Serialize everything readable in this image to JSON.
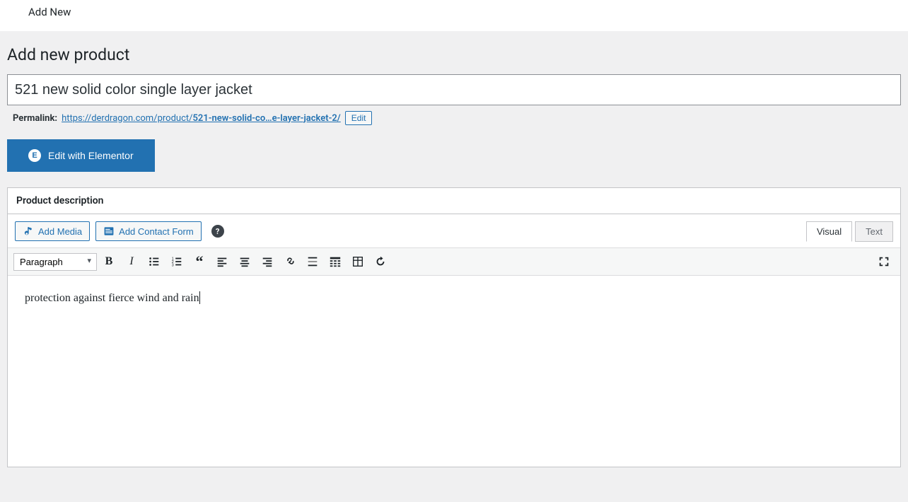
{
  "top_bar": {
    "add_new": "Add New"
  },
  "page": {
    "title": "Add new product"
  },
  "product": {
    "title": "521 new solid color single layer jacket"
  },
  "permalink": {
    "label": "Permalink:",
    "base": "https://derdragon.com/product/",
    "slug": "521-new-solid-co…e-layer-jacket-2/",
    "edit_label": "Edit"
  },
  "elementor": {
    "label": "Edit with Elementor"
  },
  "panel": {
    "title": "Product description"
  },
  "media": {
    "add_media": "Add Media",
    "add_contact_form": "Add Contact Form"
  },
  "tabs": {
    "visual": "Visual",
    "text": "Text"
  },
  "toolbar": {
    "format": "Paragraph"
  },
  "editor": {
    "content": "protection against fierce wind and rain"
  }
}
